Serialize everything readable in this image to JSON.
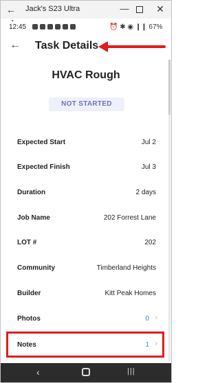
{
  "window": {
    "title": "Jack's S23 Ultra",
    "back_glyph": "←",
    "minimize_glyph": "—",
    "close_glyph": "✕"
  },
  "statusbar": {
    "time": "12:45",
    "right_icons": "⏰ ✱ ◉ ❙❙ 67%",
    "battery_label": "67%"
  },
  "header": {
    "back_glyph": "←",
    "title": "Task Details"
  },
  "task": {
    "name": "HVAC Rough",
    "status": "NOT STARTED"
  },
  "details": [
    {
      "label": "Expected Start",
      "value": "Jul 2"
    },
    {
      "label": "Expected Finish",
      "value": "Jul 3"
    },
    {
      "label": "Duration",
      "value": "2 days"
    },
    {
      "label": "Job Name",
      "value": "202 Forrest Lane"
    },
    {
      "label": "LOT #",
      "value": "202"
    },
    {
      "label": "Community",
      "value": "Timberland Heights"
    },
    {
      "label": "Builder",
      "value": "Kitt Peak Homes"
    },
    {
      "label": "Photos",
      "value": "0"
    },
    {
      "label": "Notes",
      "value": "1"
    }
  ],
  "chevron_glyph": "›",
  "navbar": {
    "back_glyph": "‹",
    "recent_glyph": "|||"
  },
  "colors": {
    "accent_link": "#3a8fd8",
    "status_badge_text": "#6c74b8",
    "annotation_red": "#e01b1b"
  },
  "icons": [
    "back-arrow-icon",
    "minimize-icon",
    "maximize-icon",
    "close-icon",
    "chevron-right-icon",
    "home-icon",
    "recent-apps-icon"
  ]
}
